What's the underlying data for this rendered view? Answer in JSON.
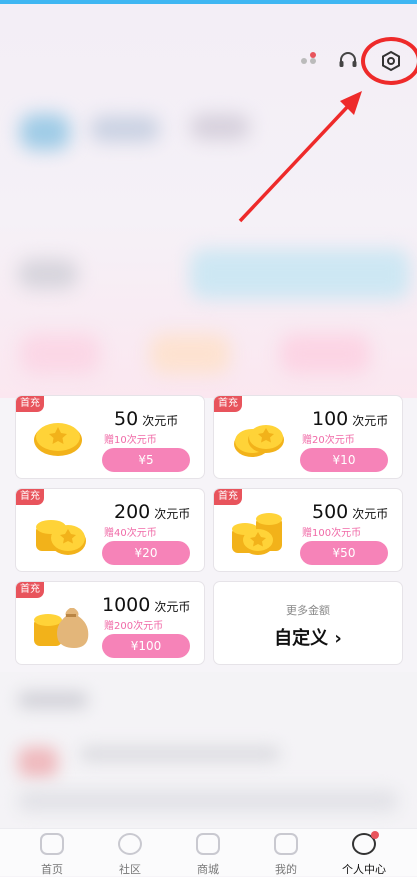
{
  "packages": [
    {
      "badge": "首充",
      "amount": "50",
      "unit": "次元币",
      "bonus": "赠10次元币",
      "price": "¥5"
    },
    {
      "badge": "首充",
      "amount": "100",
      "unit": "次元币",
      "bonus": "赠20次元币",
      "price": "¥10"
    },
    {
      "badge": "首充",
      "amount": "200",
      "unit": "次元币",
      "bonus": "赠40次元币",
      "price": "¥20"
    },
    {
      "badge": "首充",
      "amount": "500",
      "unit": "次元币",
      "bonus": "赠100次元币",
      "price": "¥50"
    },
    {
      "badge": "首充",
      "amount": "1000",
      "unit": "次元币",
      "bonus": "赠200次元币",
      "price": "¥100"
    }
  ],
  "custom": {
    "title": "更多金额",
    "label": "自定义",
    "chevron": "›"
  },
  "header": {
    "icons": [
      "share-icon",
      "headset-icon",
      "settings-icon"
    ]
  },
  "nav": {
    "items": [
      {
        "label": "首页",
        "icon": "home-icon"
      },
      {
        "label": "社区",
        "icon": "community-icon"
      },
      {
        "label": "商城",
        "icon": "shop-icon"
      },
      {
        "label": "我的",
        "icon": "folder-icon"
      },
      {
        "label": "个人中心",
        "icon": "profile-icon"
      }
    ]
  },
  "colors": {
    "accent": "#f683b8",
    "badge": "#e8545c",
    "highlight": "#ee2a2a",
    "bonus": "#f06aa7"
  }
}
